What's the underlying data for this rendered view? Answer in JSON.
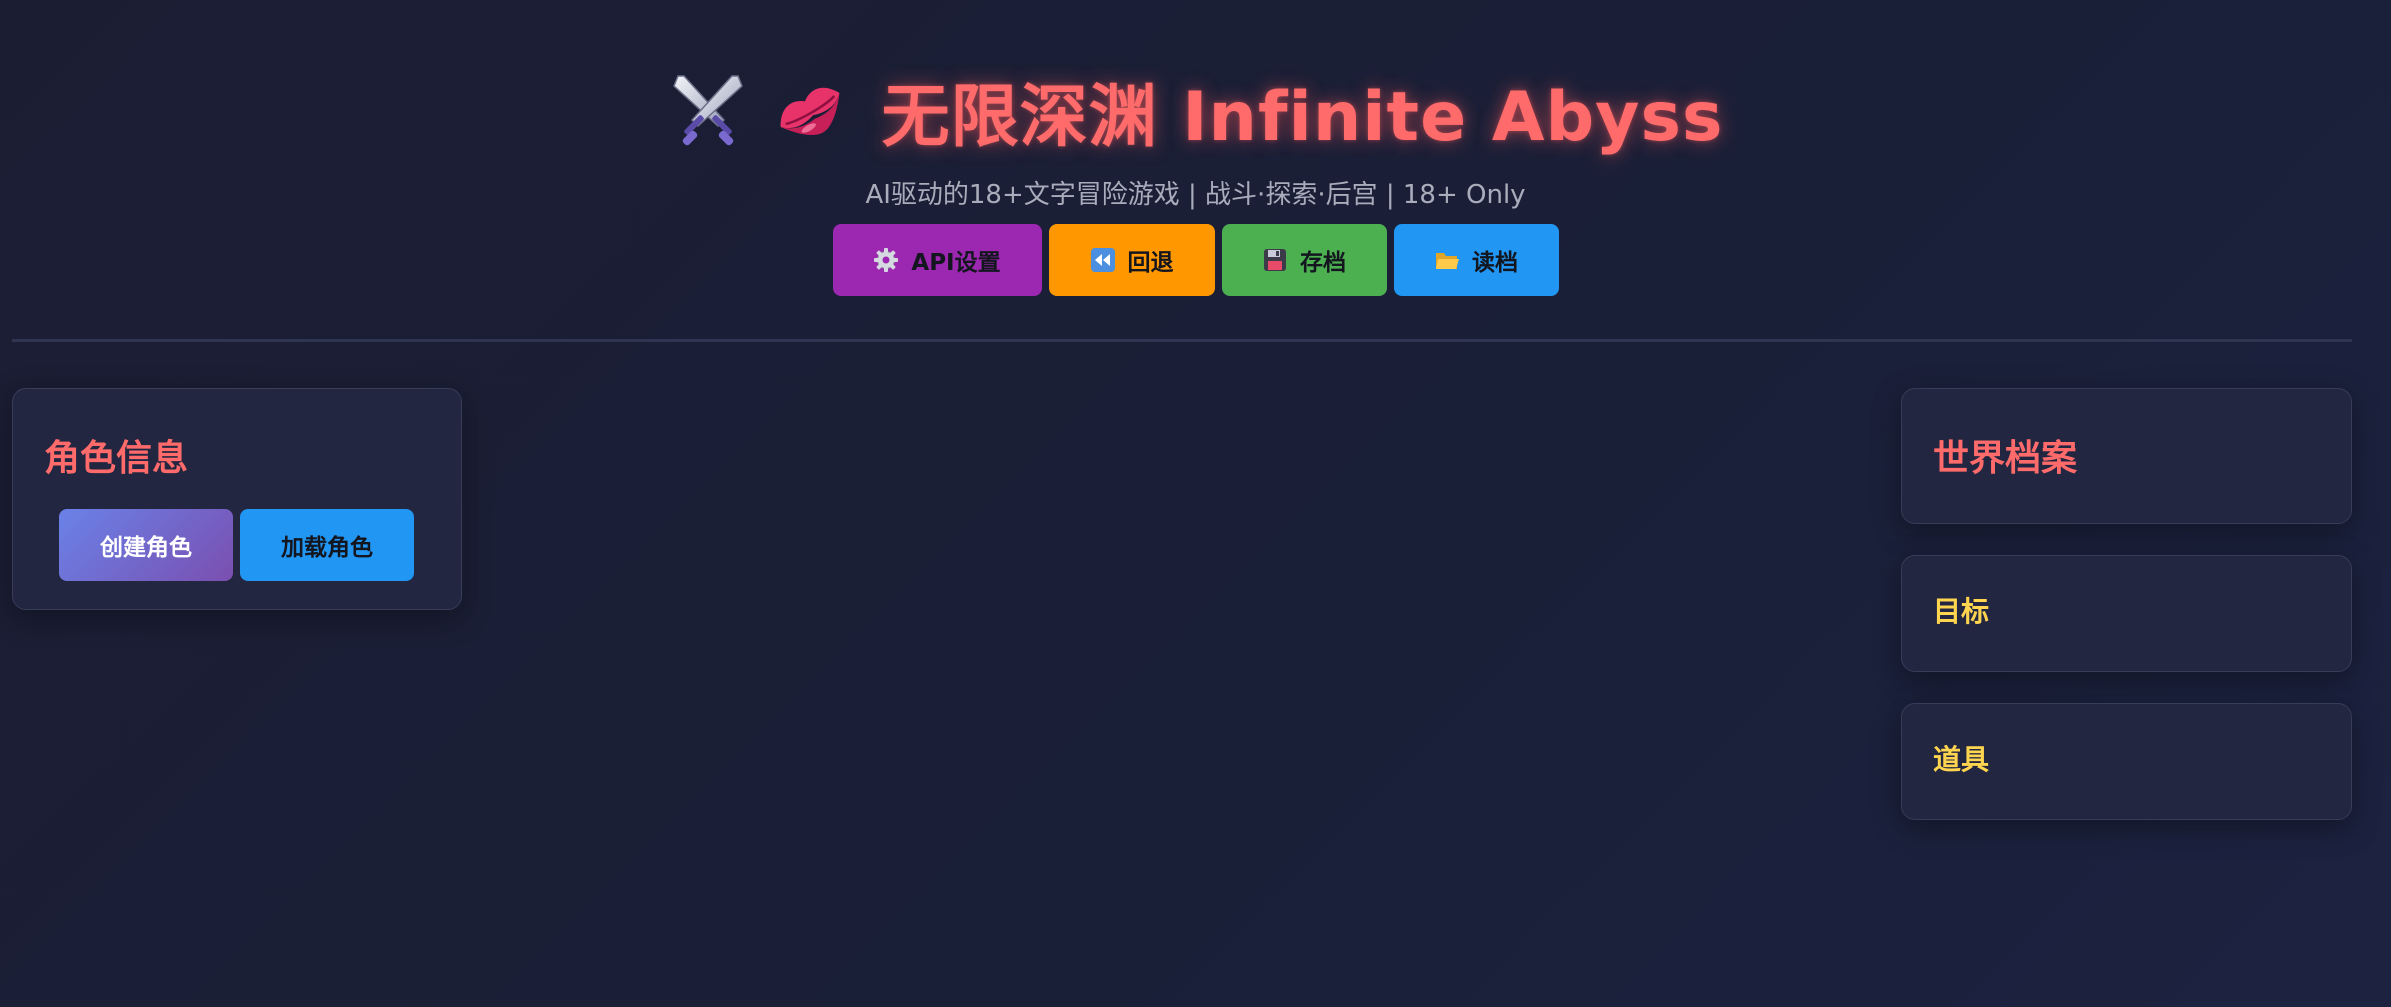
{
  "header": {
    "title": "无限深渊 Infinite Abyss",
    "title_icons": [
      "crossed-swords-icon",
      "lips-icon"
    ],
    "subtitle": "AI驱动的18+文字冒险游戏 | 战斗·探索·后宫 | 18+ Only"
  },
  "toolbar": {
    "api_label": "API设置",
    "undo_label": "回退",
    "save_label": "存档",
    "load_label": "读档",
    "icons": [
      "gear-icon",
      "rewind-icon",
      "floppy-disk-icon",
      "folder-icon"
    ],
    "colors": {
      "api": "#9c27b0",
      "undo": "#ff9800",
      "save": "#4caf50",
      "load": "#2196f3"
    }
  },
  "character_panel": {
    "title": "角色信息",
    "create_label": "创建角色",
    "load_label": "加载角色"
  },
  "world_panel": {
    "title": "世界档案"
  },
  "goal_panel": {
    "title": "目标"
  },
  "items_panel": {
    "title": "道具"
  },
  "colors": {
    "accent_red": "#ff6b6b",
    "accent_yellow": "#ffd54f",
    "background": "#1b1e33"
  }
}
